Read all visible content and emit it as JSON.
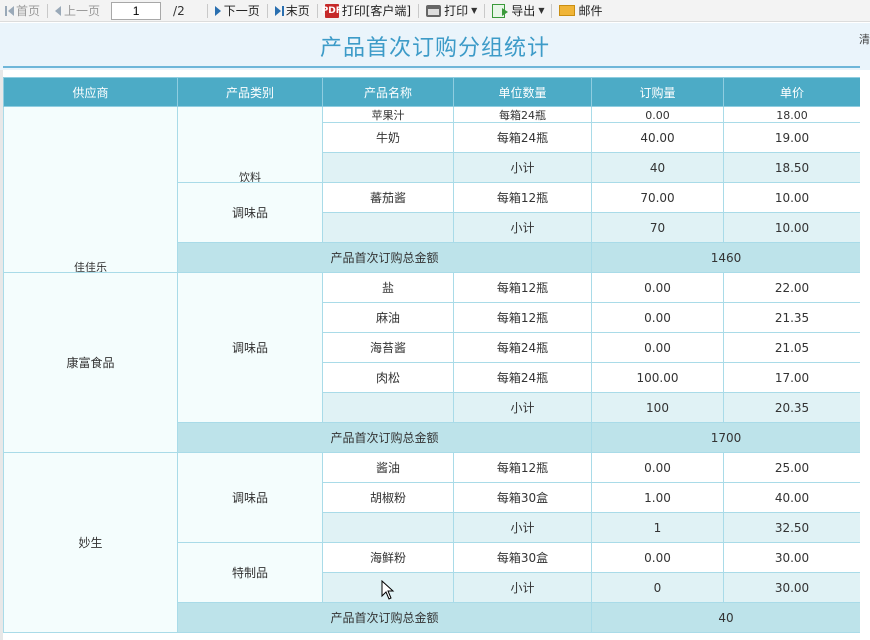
{
  "toolbar": {
    "first": "首页",
    "prev": "上一页",
    "page_value": "1",
    "page_total": "/2",
    "next": "下一页",
    "last": "末页",
    "print_client": "打印[客户端]",
    "print": "打印",
    "export": "导出",
    "mail": "邮件",
    "pdf_icon_text": "PDF"
  },
  "cut_text": "清",
  "report": {
    "title": "产品首次订购分组统计"
  },
  "table": {
    "headers": [
      "供应商",
      "产品类别",
      "产品名称",
      "单位数量",
      "订购量",
      "单价"
    ],
    "partial_row": {
      "name": "苹果汁",
      "unit": "每箱24瓶",
      "qty": "0.00",
      "price": "18.00"
    },
    "subtotal_label": "小计",
    "total_label": "产品首次订购总金额",
    "groups": [
      {
        "supplier": "佳佳乐",
        "categories": [
          {
            "name": "饮料",
            "rows": [
              {
                "name": "牛奶",
                "unit": "每箱24瓶",
                "qty": "40.00",
                "price": "19.00"
              }
            ],
            "subtotal": {
              "qty": "40",
              "price": "18.50"
            }
          },
          {
            "name": "调味品",
            "rows": [
              {
                "name": "蕃茄酱",
                "unit": "每箱12瓶",
                "qty": "70.00",
                "price": "10.00"
              }
            ],
            "subtotal": {
              "qty": "70",
              "price": "10.00"
            }
          }
        ],
        "total": "1460"
      },
      {
        "supplier": "康富食品",
        "categories": [
          {
            "name": "调味品",
            "rows": [
              {
                "name": "盐",
                "unit": "每箱12瓶",
                "qty": "0.00",
                "price": "22.00"
              },
              {
                "name": "麻油",
                "unit": "每箱12瓶",
                "qty": "0.00",
                "price": "21.35"
              },
              {
                "name": "海苔酱",
                "unit": "每箱24瓶",
                "qty": "0.00",
                "price": "21.05"
              },
              {
                "name": "肉松",
                "unit": "每箱24瓶",
                "qty": "100.00",
                "price": "17.00"
              }
            ],
            "subtotal": {
              "qty": "100",
              "price": "20.35"
            }
          }
        ],
        "total": "1700"
      },
      {
        "supplier": "妙生",
        "categories": [
          {
            "name": "调味品",
            "rows": [
              {
                "name": "酱油",
                "unit": "每箱12瓶",
                "qty": "0.00",
                "price": "25.00"
              },
              {
                "name": "胡椒粉",
                "unit": "每箱30盒",
                "qty": "1.00",
                "price": "40.00"
              }
            ],
            "subtotal": {
              "qty": "1",
              "price": "32.50"
            }
          },
          {
            "name": "特制品",
            "rows": [
              {
                "name": "海鲜粉",
                "unit": "每箱30盒",
                "qty": "0.00",
                "price": "30.00"
              }
            ],
            "subtotal": {
              "qty": "0",
              "price": "30.00"
            }
          }
        ],
        "total": "40"
      }
    ]
  },
  "colors": {
    "header_bg": "#4cabc6",
    "title_color": "#3d9bc8",
    "subtotal_bg": "#e0f2f5",
    "total_bg": "#bde3ea",
    "group_bg": "#f4fdfd"
  }
}
